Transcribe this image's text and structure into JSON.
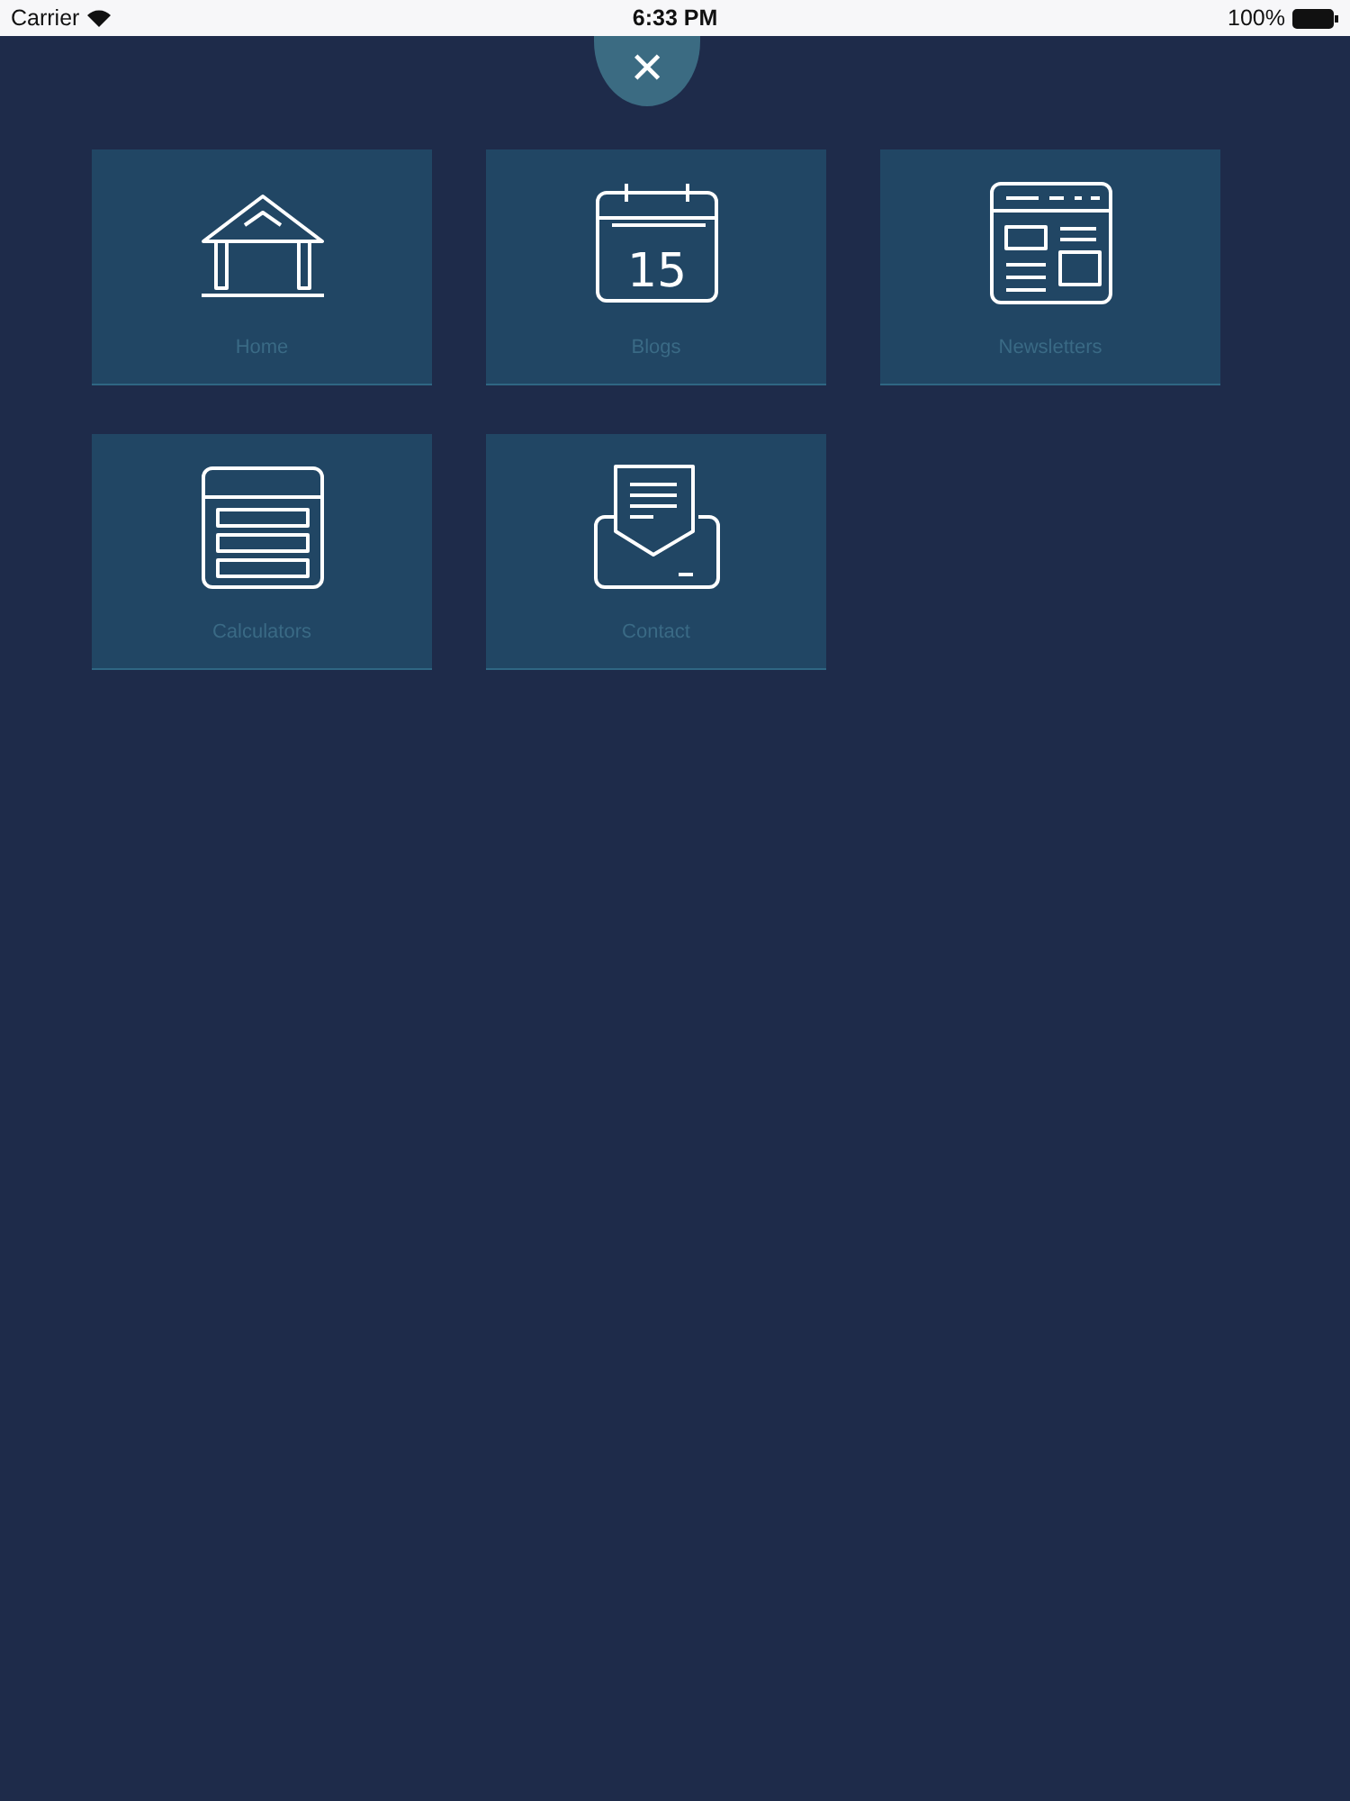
{
  "status_bar": {
    "carrier": "Carrier",
    "time": "6:33 PM",
    "battery": "100%"
  },
  "close_button": {
    "label": "✕"
  },
  "tiles": [
    {
      "kind": "home",
      "label": "Home"
    },
    {
      "kind": "calendar",
      "label": "Blogs",
      "day": "15"
    },
    {
      "kind": "newsletter",
      "label": "Newsletters"
    },
    {
      "kind": "calculator",
      "label": "Calculators"
    },
    {
      "kind": "contact",
      "label": "Contact"
    }
  ]
}
